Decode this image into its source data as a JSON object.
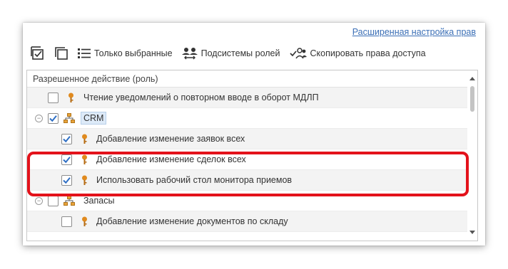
{
  "header": {
    "advanced_link": "Расширенная настройка прав"
  },
  "toolbar": {
    "buttons": [
      {
        "label": "",
        "icon": "check-all-icon"
      },
      {
        "label": "",
        "icon": "uncheck-all-icon"
      },
      {
        "label": "Только выбранные",
        "icon": "list-icon"
      },
      {
        "label": "Подсистемы ролей",
        "icon": "users-icon"
      },
      {
        "label": "Скопировать права доступа",
        "icon": "copy-users-icon"
      }
    ]
  },
  "list": {
    "header": "Разрешенное действие (роль)",
    "rows": [
      {
        "label": "Чтение уведомлений о повторном вводе в оборот МДЛП",
        "checked": false,
        "icon": "key-icon",
        "level": 1
      },
      {
        "label": "CRM",
        "checked": true,
        "icon": "org-structure-icon",
        "level": 0,
        "expanded": true,
        "selected": true
      },
      {
        "label": "Добавление изменение заявок всех",
        "checked": true,
        "icon": "key-icon",
        "level": 1
      },
      {
        "label": "Добавление изменение сделок всех",
        "checked": true,
        "icon": "key-icon",
        "level": 1
      },
      {
        "label": "Использовать рабочий стол монитора приемов",
        "checked": true,
        "icon": "key-icon",
        "level": 1
      },
      {
        "label": "Запасы",
        "checked": false,
        "icon": "org-structure-icon",
        "level": 0,
        "expanded": true
      },
      {
        "label": "Добавление изменение документов по складу",
        "checked": false,
        "icon": "key-icon",
        "level": 1
      }
    ]
  },
  "colors": {
    "link": "#3b6fb6",
    "checkmark": "#2f6fc4",
    "highlight": "#e3121b",
    "key_icon": "#e08a1e"
  }
}
